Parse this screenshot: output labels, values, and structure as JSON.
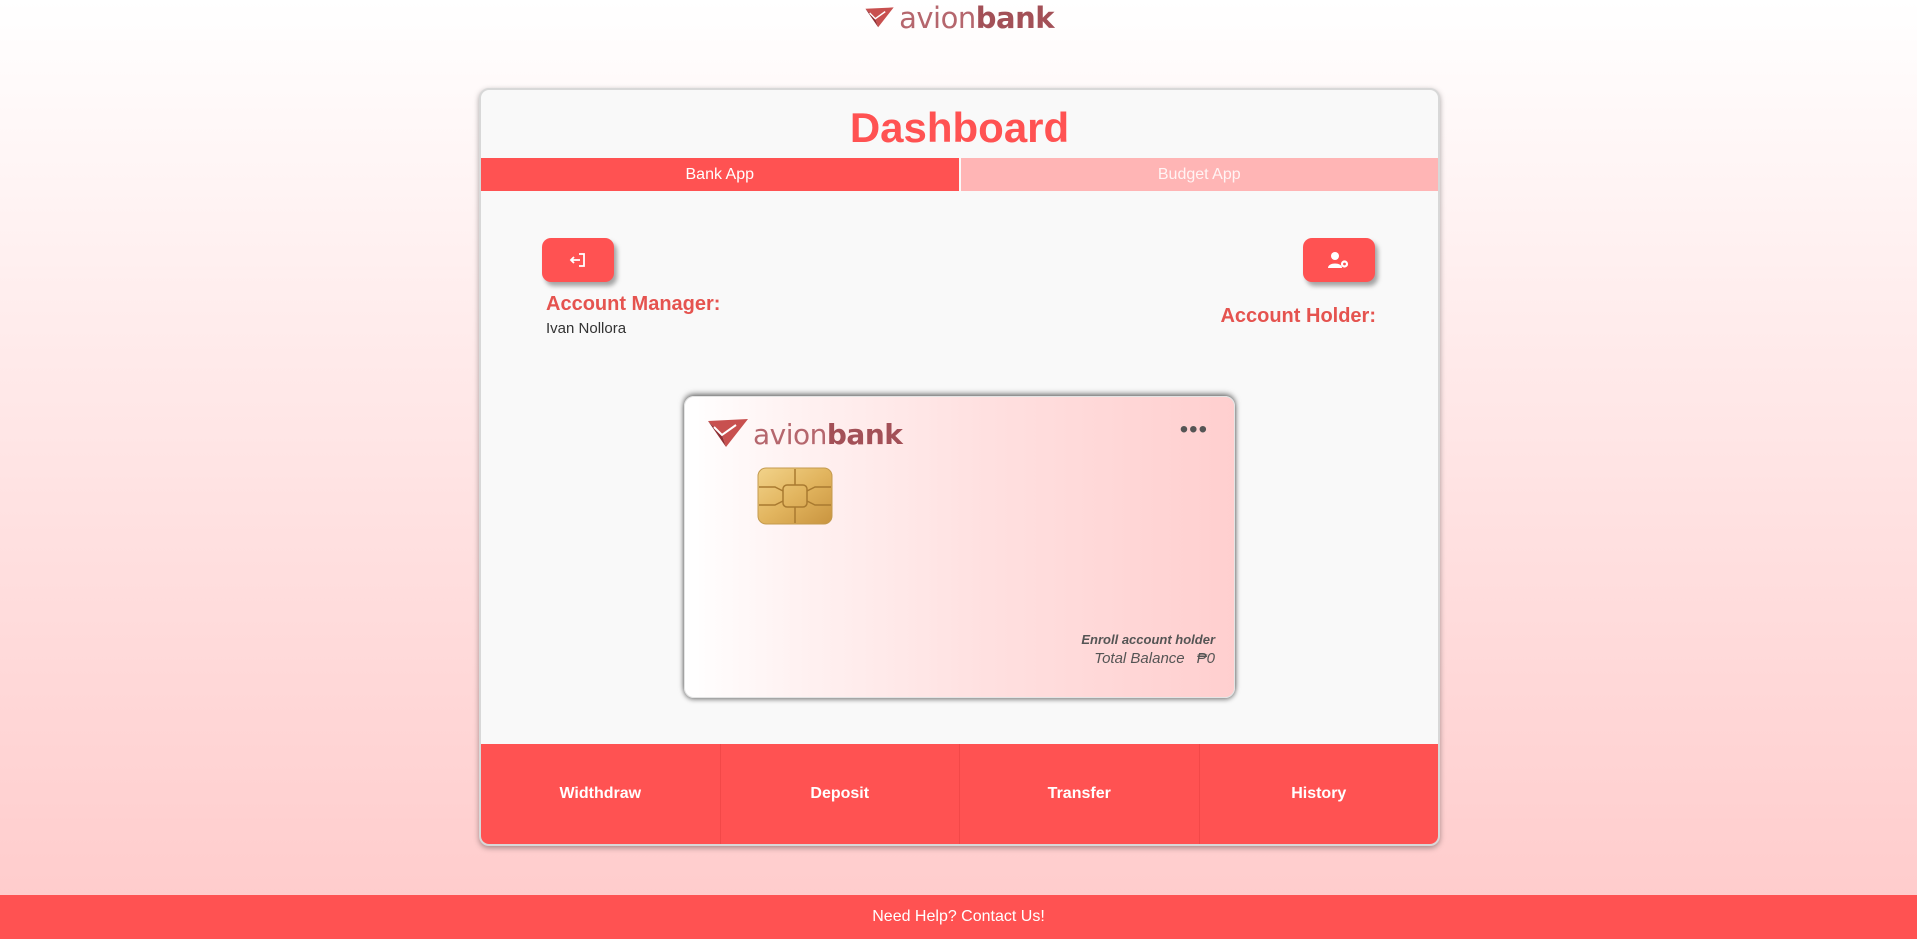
{
  "brand": {
    "logo_prefix": "avion",
    "logo_suffix": "bank",
    "card_logo_prefix": "avion",
    "card_logo_suffix": "bank"
  },
  "dashboard": {
    "title": "Dashboard",
    "tabs": [
      {
        "label": "Bank App",
        "active": true
      },
      {
        "label": "Budget App",
        "active": false
      }
    ]
  },
  "account": {
    "manager_heading": "Account Manager:",
    "manager_name": "Ivan Nollora",
    "holder_heading": "Account Holder:"
  },
  "icons": {
    "logout": "logout-icon",
    "settings": "user-settings-icon",
    "more": "more-horizontal-icon",
    "chip": "card-chip-icon",
    "logo": "paper-plane-logo-icon"
  },
  "card": {
    "more_glyph": "•••",
    "enroll_label": "Enroll account holder",
    "balance_label": "Total Balance",
    "balance_value": "₱0"
  },
  "actions": [
    {
      "label": "Widthdraw"
    },
    {
      "label": "Deposit"
    },
    {
      "label": "Transfer"
    },
    {
      "label": "History"
    }
  ],
  "footer": {
    "help_text": "Need Help? Contact Us!"
  },
  "colors": {
    "primary": "#ff5252",
    "tab_inactive": "#ffb5b5",
    "logo": "#b5666d"
  }
}
